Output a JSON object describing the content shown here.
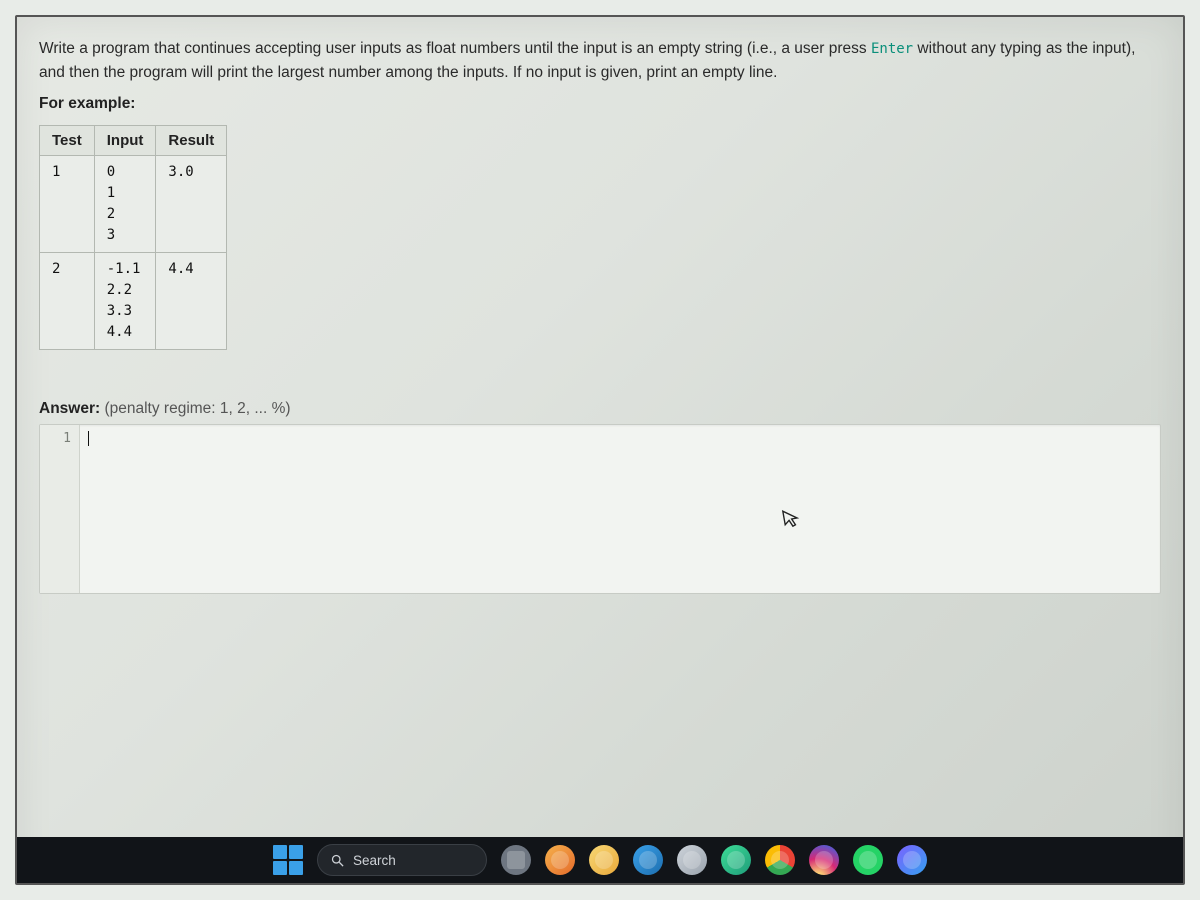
{
  "problem": {
    "text_before_enter": "Write a program that continues accepting user inputs as float numbers until the input is an empty string (i.e., a user press ",
    "enter_token": "Enter",
    "text_after_enter": " without any typing as the input), and then the program will print the largest number among the inputs. If no input is given, print an empty line.",
    "for_example_label": "For example:"
  },
  "table": {
    "headers": {
      "test": "Test",
      "input": "Input",
      "result": "Result"
    },
    "rows": [
      {
        "test": "1",
        "input": "0\n1\n2\n3",
        "result": "3.0"
      },
      {
        "test": "2",
        "input": "-1.1\n2.2\n3.3\n4.4",
        "result": "4.4"
      }
    ]
  },
  "answer": {
    "label": "Answer:",
    "regime": "(penalty regime: 1, 2, ... %)"
  },
  "editor": {
    "line_number": "1",
    "code": ""
  },
  "taskbar": {
    "search_label": "Search"
  }
}
